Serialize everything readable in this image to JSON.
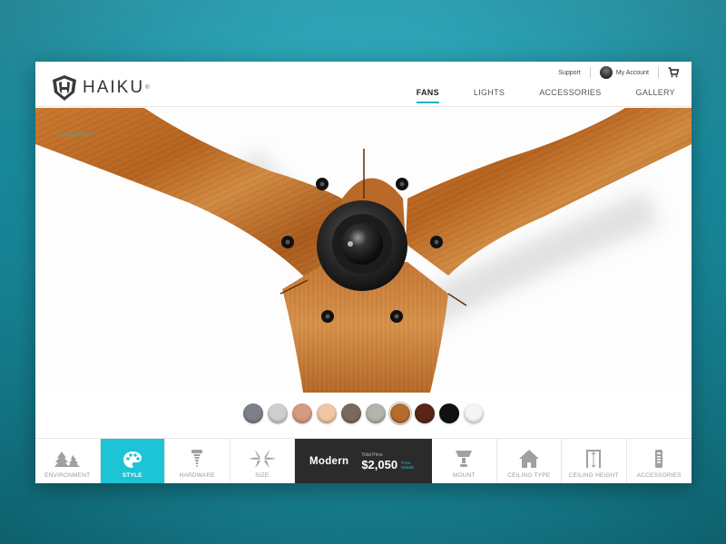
{
  "header": {
    "brand": "HAIKU",
    "utility": {
      "support": "Support",
      "account": "My Account"
    },
    "nav": [
      {
        "label": "FANS",
        "active": true
      },
      {
        "label": "LIGHTS",
        "active": false
      },
      {
        "label": "ACCESSORIES",
        "active": false
      },
      {
        "label": "GALLERY",
        "active": false
      }
    ]
  },
  "hero": {
    "breadcrumb": "‹ Change Model"
  },
  "swatches": [
    {
      "name": "graphite",
      "color": "#7d8087"
    },
    {
      "name": "silver",
      "color": "#cfcfcf"
    },
    {
      "name": "copper",
      "color": "#d49a84"
    },
    {
      "name": "blush",
      "color": "#f0c6a4"
    },
    {
      "name": "bronze",
      "color": "#7a6a5e"
    },
    {
      "name": "nickel",
      "color": "#b4b4ae"
    },
    {
      "name": "bamboo",
      "color": "#b56d2c"
    },
    {
      "name": "cocoa",
      "color": "#5a2418"
    },
    {
      "name": "black",
      "color": "#111111"
    },
    {
      "name": "white",
      "color": "#f5f5f5"
    }
  ],
  "toolbar": {
    "environment": "ENVIRONMENT",
    "style": "STYLE",
    "hardware": "HARDWARE",
    "size": "SIZE",
    "mount": "MOUNT",
    "ceiling_type": "CEILING TYPE",
    "ceiling_height": "CEILING HEIGHT",
    "accessories": "ACCESSORIES"
  },
  "price": {
    "style_name": "Modern",
    "label": "Total Price",
    "value": "$2,050",
    "details": "Price Details"
  },
  "colors": {
    "accent": "#1cc4d6",
    "dark": "#2b2b2b"
  }
}
